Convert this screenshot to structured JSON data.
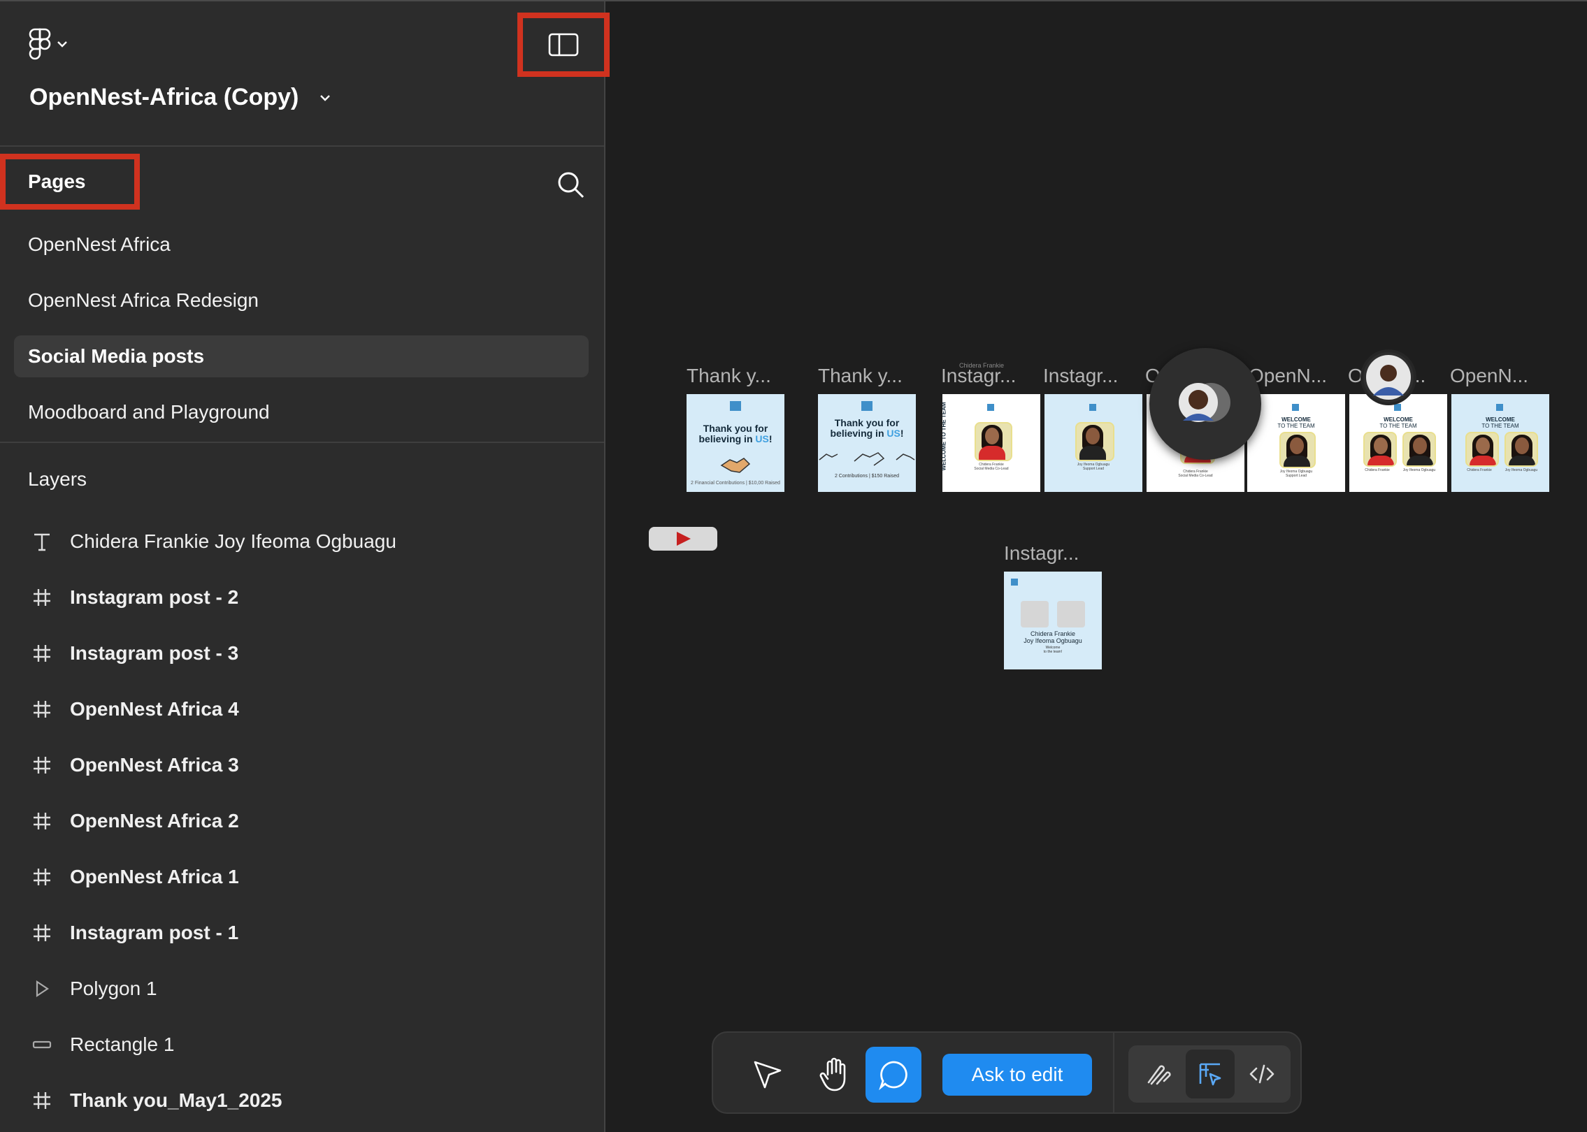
{
  "app": {
    "file_title": "OpenNest-Africa (Copy)"
  },
  "pages": {
    "label": "Pages",
    "items": [
      {
        "label": "OpenNest Africa"
      },
      {
        "label": "OpenNest Africa Redesign"
      },
      {
        "label": "Social Media posts",
        "active": true
      },
      {
        "label": "Moodboard and Playground"
      }
    ]
  },
  "layers": {
    "label": "Layers",
    "items": [
      {
        "label": "Chidera Frankie Joy Ifeoma Ogbuagu",
        "icon": "text-icon"
      },
      {
        "label": "Instagram post - 2",
        "icon": "frame-icon"
      },
      {
        "label": "Instagram post - 3",
        "icon": "frame-icon"
      },
      {
        "label": "OpenNest Africa 4",
        "icon": "frame-icon"
      },
      {
        "label": "OpenNest Africa 3",
        "icon": "frame-icon"
      },
      {
        "label": "OpenNest Africa 2",
        "icon": "frame-icon"
      },
      {
        "label": "OpenNest Africa 1",
        "icon": "frame-icon"
      },
      {
        "label": "Instagram post - 1",
        "icon": "frame-icon"
      },
      {
        "label": "Polygon 1",
        "icon": "polygon-icon"
      },
      {
        "label": "Rectangle 1",
        "icon": "rectangle-icon"
      },
      {
        "label": "Thank you_May1_2025",
        "icon": "frame-icon"
      }
    ]
  },
  "canvas": {
    "frame_labels": [
      "Thank y...",
      "Thank y...",
      "Instagr...",
      "Instagr...",
      "O",
      "OpenN...",
      "O",
      "...",
      "OpenN...",
      "Instagr..."
    ],
    "thumbs": {
      "thank_head_1": "Thank you for",
      "thank_head_2": "believing in",
      "thank_head_us": "US",
      "thank_head_bang": "!",
      "thank_foot_1": "2 Financial Contributions | $10,00 Raised",
      "thank_foot_2": "2 Contributions | $150 Raised",
      "welcome_1": "WELCOME",
      "welcome_2": "TO THE TEAM",
      "cap_name": "Chidera Frankie",
      "cap_role": "Social Media Co-Lead",
      "cap_name2": "Joy Ifeoma Ogbuagu",
      "cap_role2": "Support Lead",
      "small_top_label": "Chidera Frankie",
      "insta_bottom_name_1": "Chidera Frankie",
      "insta_bottom_name_2": "Joy Ifeoma Ogbuagu",
      "insta_bottom_welcome_1": "Welcome",
      "insta_bottom_welcome_2": "to the team!"
    }
  },
  "toolbar": {
    "ask_to_edit": "Ask to edit"
  },
  "colors": {
    "accent": "#1f8bf0",
    "highlight": "#d0321f",
    "sidebar_bg": "#2c2c2c",
    "canvas_bg": "#1e1e1e",
    "thumb_blue": "#d6ebf8"
  }
}
